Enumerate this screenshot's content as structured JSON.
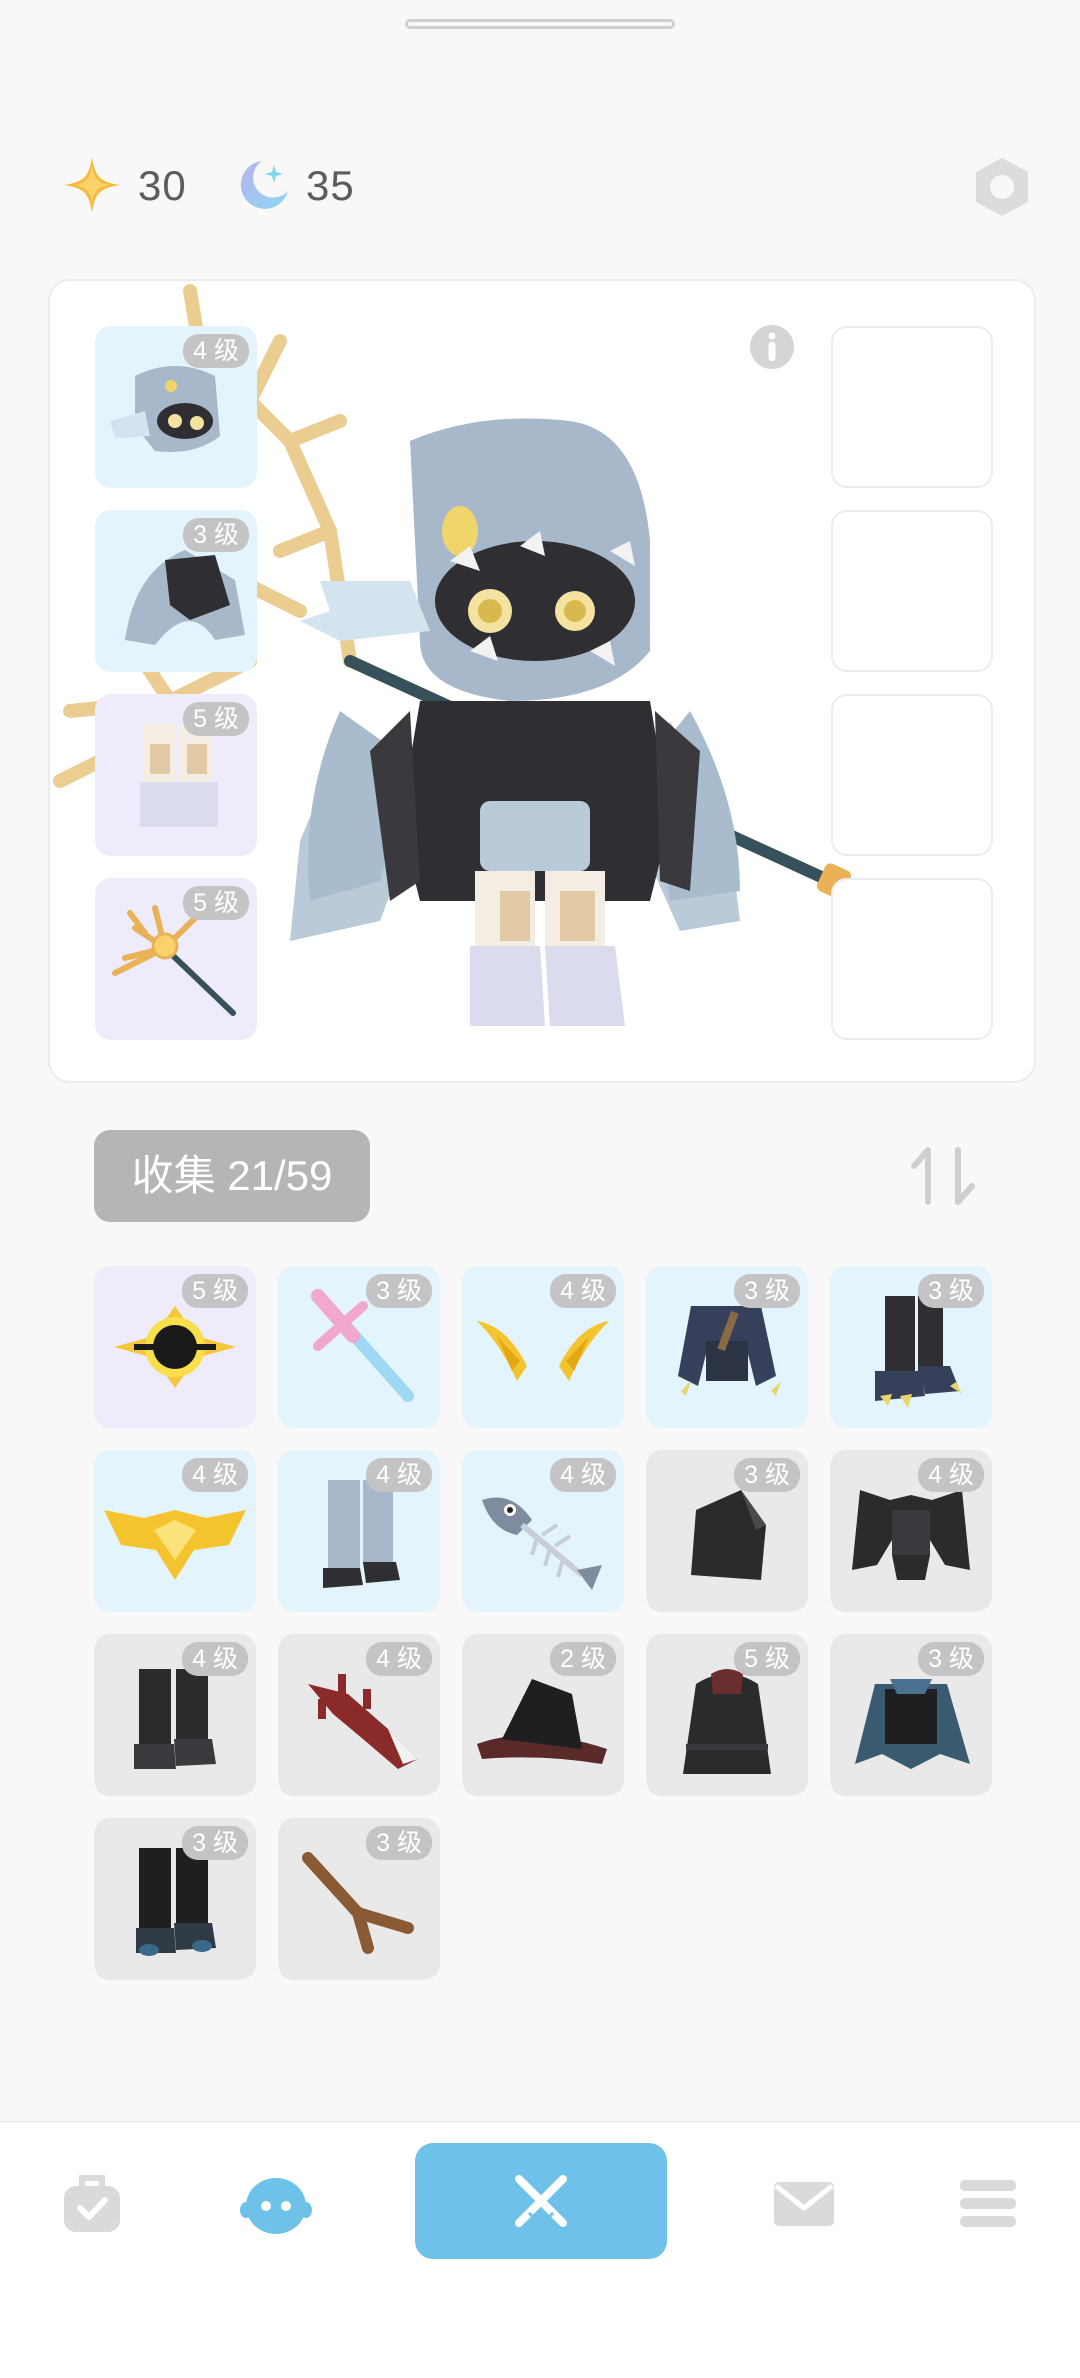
{
  "header": {
    "star_count": "30",
    "moon_count": "35",
    "icons": [
      "star-icon",
      "moon-icon",
      "settings-hexagon-icon"
    ]
  },
  "equipped": {
    "slots": [
      {
        "level": "4 级",
        "item": "helmet",
        "bg": "#e3f4fd"
      },
      {
        "level": "3 级",
        "item": "cape",
        "bg": "#e3f4fd"
      },
      {
        "level": "5 级",
        "item": "boots",
        "bg": "#eeebfb"
      },
      {
        "level": "5 级",
        "item": "staff",
        "bg": "#eeebfb"
      }
    ],
    "empty_slots": 4
  },
  "collection": {
    "label": "收集 21/59",
    "items": [
      {
        "level": "5 级",
        "item": "black-hole-orb",
        "rarity": "purple"
      },
      {
        "level": "3 级",
        "item": "pink-sword",
        "rarity": "blue"
      },
      {
        "level": "4 级",
        "item": "golden-wings",
        "rarity": "blue"
      },
      {
        "level": "3 级",
        "item": "dark-claw-armor",
        "rarity": "blue"
      },
      {
        "level": "3 级",
        "item": "dark-claw-legs",
        "rarity": "blue"
      },
      {
        "level": "4 级",
        "item": "golden-crown-wings",
        "rarity": "blue"
      },
      {
        "level": "4 级",
        "item": "gray-legs",
        "rarity": "blue"
      },
      {
        "level": "4 级",
        "item": "fish-bone",
        "rarity": "blue"
      },
      {
        "level": "3 级",
        "item": "black-hood",
        "rarity": "gray"
      },
      {
        "level": "4 级",
        "item": "black-spiky-armor",
        "rarity": "gray"
      },
      {
        "level": "4 级",
        "item": "black-boots",
        "rarity": "gray"
      },
      {
        "level": "4 级",
        "item": "red-bone-sword",
        "rarity": "gray"
      },
      {
        "level": "2 级",
        "item": "witch-hat",
        "rarity": "gray"
      },
      {
        "level": "5 级",
        "item": "black-cloak",
        "rarity": "gray"
      },
      {
        "level": "3 级",
        "item": "blue-cape",
        "rarity": "gray"
      },
      {
        "level": "3 级",
        "item": "dark-blue-boots",
        "rarity": "gray"
      },
      {
        "level": "3 级",
        "item": "wood-branch",
        "rarity": "gray"
      }
    ]
  },
  "nav": {
    "items": [
      "bag-icon",
      "character-icon",
      "battle-icon",
      "mail-icon",
      "menu-icon"
    ],
    "active": "battle-icon"
  },
  "colors": {
    "accent": "#6ec2ea",
    "blue_bg": "#e3f4fd",
    "purple_bg": "#eeebfb",
    "gray_bg": "#e9e9e9"
  }
}
